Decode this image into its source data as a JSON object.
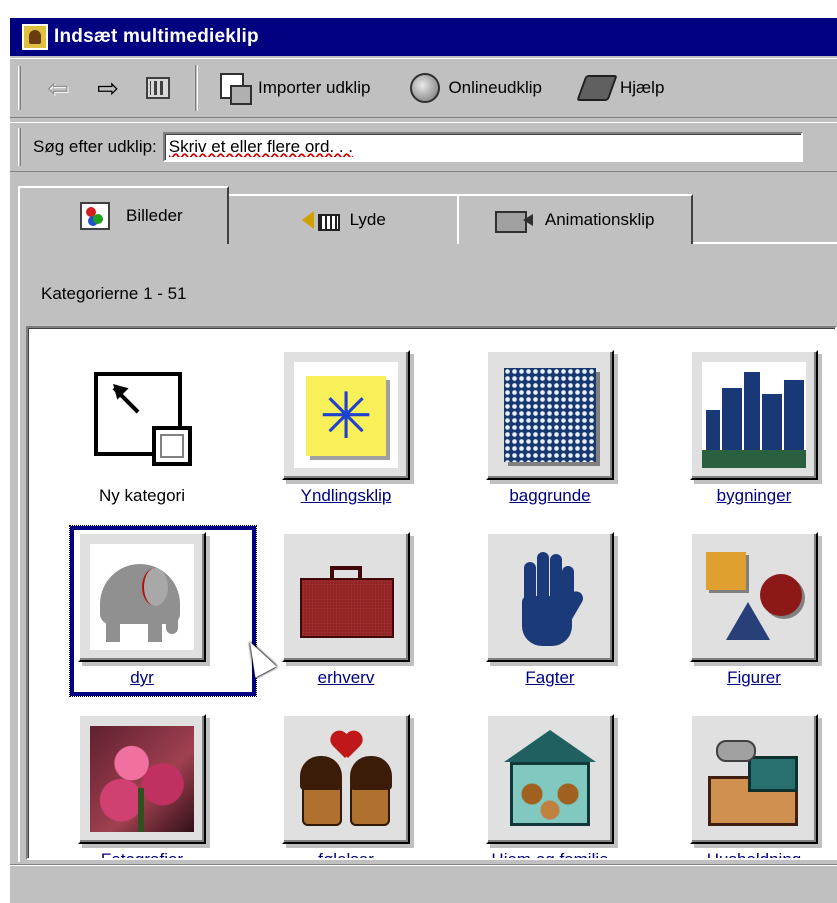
{
  "window": {
    "title": "Indsæt multimedieklip"
  },
  "toolbar": {
    "back_icon": "back-arrow-icon",
    "forward_icon": "forward-arrow-icon",
    "view_icon": "grid-view-icon",
    "import_label": "Importer udklip",
    "online_label": "Onlineudklip",
    "help_label": "Hjælp"
  },
  "search": {
    "label": "Søg efter udklip:",
    "placeholder": "Skriv et eller flere ord. . ."
  },
  "tabs": [
    {
      "label": "Billeder",
      "icon": "pictures-icon",
      "active": true
    },
    {
      "label": "Lyde",
      "icon": "sounds-icon",
      "active": false
    },
    {
      "label": "Animationsklip",
      "icon": "animation-icon",
      "active": false
    }
  ],
  "range_label": "Kategorierne 1 - 51",
  "categories": [
    {
      "label": "Ny kategori",
      "icon": "new-category-icon"
    },
    {
      "label": "Yndlingsklip",
      "icon": "star-icon"
    },
    {
      "label": "baggrunde",
      "icon": "dot-pattern-icon"
    },
    {
      "label": "bygninger",
      "icon": "buildings-icon"
    },
    {
      "label": "dyr",
      "icon": "elephant-icon",
      "selected": true
    },
    {
      "label": "erhverv",
      "icon": "briefcase-icon"
    },
    {
      "label": "Fagter",
      "icon": "hand-icon"
    },
    {
      "label": "Figurer",
      "icon": "shapes-icon"
    },
    {
      "label": "Fotografier",
      "icon": "tulip-photo-icon"
    },
    {
      "label": "følelser",
      "icon": "couple-heart-icon"
    },
    {
      "label": "Hjem og familie",
      "icon": "house-family-icon"
    },
    {
      "label": "Husholdning",
      "icon": "kitchen-icon"
    }
  ],
  "colors": {
    "titlebar": "#000080",
    "face": "#c0c0c0",
    "link": "#000080"
  }
}
